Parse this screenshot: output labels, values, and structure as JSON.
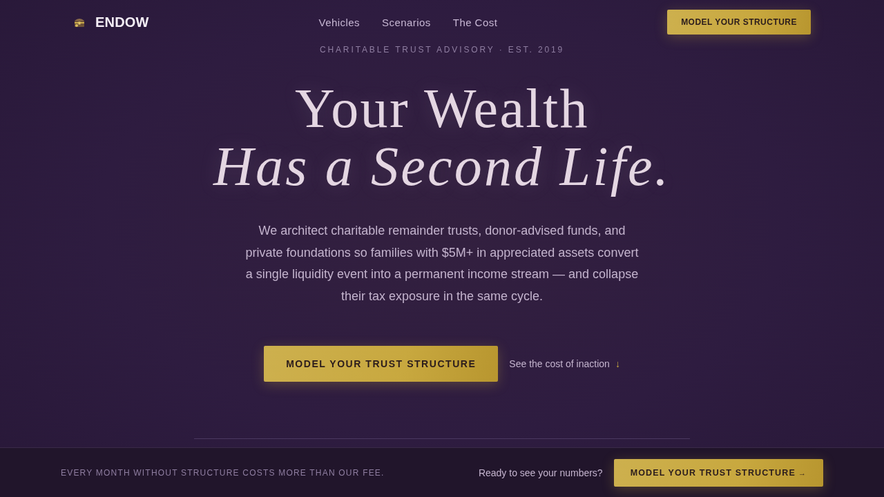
{
  "header": {
    "brand": "ENDOW",
    "nav": [
      "Vehicles",
      "Scenarios",
      "The Cost"
    ],
    "cta": "MODEL YOUR STRUCTURE"
  },
  "hero": {
    "eyebrow": "CHARITABLE TRUST ADVISORY · EST. 2019",
    "title_line_1": "Your Wealth",
    "title_line_2": "Has a Second Life.",
    "intro": "We architect charitable remainder trusts, donor-advised funds, and private foundations so families with $5M+ in appreciated assets convert a single liquidity event into a permanent income stream — and collapse their tax exposure in the same cycle.",
    "primary_button": "MODEL YOUR TRUST STRUCTURE",
    "secondary_link": {
      "label": "See the cost of inaction",
      "arrow": "↓"
    }
  },
  "bottom_bar": {
    "message": "EVERY MONTH WITHOUT STRUCTURE COSTS MORE THAN OUR FEE.",
    "prompt": "Ready to see your numbers?",
    "button": {
      "label": "MODEL YOUR TRUST STRUCTURE",
      "arrow": "→"
    }
  }
}
